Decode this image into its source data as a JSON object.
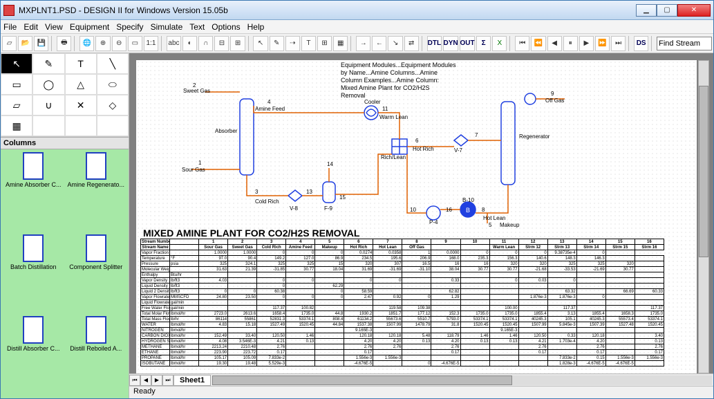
{
  "window": {
    "title": "MXPLNT1.PSD - DESIGN II for Windows Version 15.05b"
  },
  "menu": [
    "File",
    "Edit",
    "View",
    "Equipment",
    "Specify",
    "Simulate",
    "Text",
    "Options",
    "Help"
  ],
  "toolbar": {
    "find_placeholder": "Find Stream",
    "text_btns": [
      "DTL",
      "DYN",
      "OUT",
      "Σ",
      "DS"
    ]
  },
  "shape_tools": [
    "↖",
    "✎",
    "T",
    "╲",
    "▭",
    "◯",
    "△",
    "⬭",
    "▱",
    "∪",
    "✕",
    "◇",
    "▦"
  ],
  "columns_header": "Columns",
  "palette": [
    "Amine Absorber C...",
    "Amine Regenerato...",
    "Batch Distillation",
    "Component Splitter",
    "Distill Absorber C...",
    "Distill Reboiled A..."
  ],
  "sheet_tab": "Sheet1",
  "status": "Ready",
  "note_lines": [
    "Equipment Modules...Equipment Modules",
    "by Name...Amine Columns...Amine",
    "Column Examples...Amine Column:",
    "Mixed Amine Plant for CO2/H2S",
    "Removal"
  ],
  "diagram_title": "MIXED AMINE PLANT FOR CO2/H2S REMOVAL",
  "diagram_labels": {
    "sweet_gas": "Sweet Gas",
    "amine_feed": "Amine Feed",
    "absorber": "Absorber",
    "sour_gas": "Sour Gas",
    "cold_rich": "Cold Rich",
    "v8": "V-8",
    "f9": "F-9",
    "cooler": "Cooler",
    "warm_lean": "Warm Lean",
    "rich_lean": "Rich/Lean",
    "hot_rich": "Hot Rich",
    "v7": "V-7",
    "p4": "P-4",
    "b10": "B-10",
    "hot_lean": "Hot Lean",
    "makeup": "Makeup",
    "regenerator": "Regenerator",
    "off_gas": "Off Gas",
    "n2": "2",
    "n3": "3",
    "n4": "4",
    "n5": "5",
    "n6": "6",
    "n7": "7",
    "n8": "8",
    "n9": "9",
    "n10": "10",
    "n11": "11",
    "n13": "13",
    "n14": "14",
    "n15": "15",
    "n16": "16",
    "n1": "1"
  },
  "table": {
    "header": [
      "Stream Number",
      "",
      "1",
      "2",
      "3",
      "4",
      "5",
      "6",
      "7",
      "8",
      "9",
      "10",
      "11",
      "12",
      "13",
      "14",
      "15",
      "16"
    ],
    "sub": [
      "Stream Name",
      "",
      "Sour Gas",
      "Sweet Gas",
      "Cold Rich",
      "Amine Feed",
      "Makeup",
      "Hot Rich",
      "Hot Lean",
      "Off Gas",
      "",
      "",
      "Warm Lean",
      "Strm 12",
      "Strm 13",
      "Strm 14",
      "Strm 15",
      "Strm 16"
    ],
    "rows": [
      [
        "Vapor Fraction",
        "",
        "1.0000",
        "1.0000",
        "0",
        "0",
        "0",
        "0.0274",
        "0.0358",
        "1",
        "0.0000",
        "0",
        "0",
        "0",
        "9.38735e-4",
        "0",
        ""
      ],
      [
        "Temperature",
        "°F",
        "97.0",
        "90.4",
        "149.2",
        "127.0",
        "86.9",
        "234.5",
        "195.6",
        "206.9",
        "168.0",
        "235.3",
        "156.3",
        "140.6",
        "148.3",
        "146.3",
        "",
        ""
      ],
      [
        "Pressure",
        "psia",
        "325",
        "324.1",
        "325",
        "325",
        "15",
        "320",
        "307",
        "16.5",
        "16",
        "16",
        "320",
        "320",
        "325",
        "325",
        "320",
        ""
      ],
      [
        "Molecular Weight",
        "",
        "31.63",
        "21.39",
        "-31.85",
        "30.77",
        "18.04",
        "31.69",
        "-31.69",
        "-31.10",
        "38.04",
        "30.77",
        "30.77",
        "-21.68",
        "-33.53",
        "-21.69",
        "30.77",
        ""
      ],
      [
        "Enthalpy",
        "Btu/hr",
        "",
        "",
        "",
        "",
        "",
        "",
        "",
        "",
        "",
        "",
        "",
        "",
        "",
        "",
        "",
        ""
      ],
      [
        "Vapor Density",
        "lb/ft3",
        "4.03",
        "",
        "0",
        "0",
        "",
        "0",
        "0",
        "",
        "0.33",
        "",
        "0",
        "0.03",
        "0",
        "",
        "",
        ""
      ],
      [
        "Liquid Density",
        "lb/ft3",
        "",
        "",
        "0",
        "",
        "62.29",
        "",
        "",
        "",
        "",
        "",
        "",
        "",
        "",
        "",
        "",
        ""
      ],
      [
        "Liquid 2 Density",
        "lb/ft3",
        "0",
        "0",
        "60.38",
        "",
        "0",
        "58.59",
        "",
        "",
        "62.82",
        "",
        "",
        "",
        "63.32",
        "",
        "66.69",
        "60.33"
      ],
      [
        "Vapor Flowrate (STP)",
        "MMSCFD",
        "24.80",
        "23.50",
        "0",
        "0",
        "0",
        "2.47",
        "0.92",
        "0",
        "1.29",
        "",
        "",
        "1.876e-3",
        "1.876e-3",
        "0",
        "",
        ""
      ],
      [
        "Liquid Flowrate",
        "gal/min",
        "",
        "",
        "",
        "",
        "",
        "",
        "",
        "",
        "",
        "",
        "",
        "",
        "",
        "",
        "",
        ""
      ],
      [
        "Free Water Flowrate (STP)",
        "gal/min",
        "",
        "",
        "117.37",
        "100.82",
        "",
        "",
        "119.58",
        "109.38",
        "",
        "",
        "100.00",
        "",
        "117.37",
        "",
        "",
        "117.37"
      ],
      [
        "Total Molar Flowrate",
        "lbmol/hr",
        "2723.0",
        "2613.6",
        "1658.4",
        "1735.0",
        "44.8",
        "1930.2",
        "1851.7",
        "177.12",
        "152.3",
        "1735.0",
        "1735.0",
        "1855.4",
        "3.13",
        "1855.4",
        "1658.3",
        "1735.0"
      ],
      [
        "Total Mass Flowrate",
        "lb/hr",
        "86114",
        "55861",
        "52831.3",
        "53374.1",
        "808.4",
        "61134.2",
        "55673.6",
        "5510.7",
        "5793.0",
        "53374.1",
        "53374.1",
        "40245.3",
        "105.1",
        "40245.3",
        "55573.4",
        "53374.1"
      ],
      [
        "WATER",
        "lbmol/hr",
        "4.83",
        "15.18",
        "1527.49",
        "1520.45",
        "44.84",
        "1537.38",
        "1507.99",
        "1478.79",
        "31.8",
        "1520.45",
        "1520.45",
        "1507.99",
        "5.845e-3",
        "1507.39",
        "1527.48",
        "1520.45"
      ],
      [
        "NITROGEN",
        "lbmol/hr",
        "",
        "",
        "",
        "",
        "",
        "9.165E-3",
        "",
        "",
        "",
        "",
        "9.165E-3",
        "",
        "",
        "",
        "",
        ""
      ],
      [
        "CARBON DIOXIDE",
        "lbmol/hr",
        "152.49",
        "33.40",
        "120.50",
        "1.46",
        "",
        "120.18",
        "120.18",
        "5.48",
        "118.79",
        "1.46",
        "1.46",
        "120.50",
        "0.33",
        "120.18",
        "",
        "3.40"
      ],
      [
        "HYDROGEN SULFID",
        "lbmol/hr",
        "4.08",
        "3.546E-3",
        "4.21",
        "0.13",
        "",
        "4.20",
        "4.20",
        "0.13",
        "4.20",
        "0.13",
        "0.13",
        "4.21",
        "1.703e-4",
        "4.20",
        "",
        "0.13"
      ],
      [
        "METHANE",
        "lbmol/hr",
        "2213.24",
        "2210.48",
        "2.76",
        "",
        "",
        "2.76",
        "2.76",
        "",
        "2.76",
        "",
        "",
        "2.76",
        "",
        "2.76",
        "",
        "2.76"
      ],
      [
        "ETHANE",
        "lbmol/hr",
        "223.90",
        "223.72",
        "0.17",
        "",
        "",
        "0.17",
        "",
        "",
        "0.17",
        "",
        "",
        "0.17",
        "",
        "0.17",
        "",
        "0.17"
      ],
      [
        "PROPANE",
        "lbmol/hr",
        "105.17",
        "105.09",
        "7.833e-2",
        "",
        "",
        "1.556e-3",
        "1.556e-3",
        "",
        "",
        "",
        "",
        "",
        "7.833e-2",
        "0.15",
        "1.556e-3",
        "1.556e-3"
      ],
      [
        "ISOBUTANE",
        "lbmol/hr",
        "19.30",
        "19.48",
        "5.529e-3",
        "",
        "",
        "-4.676E-5",
        "",
        "0",
        "-4.676E-5",
        "",
        "",
        "",
        "1.828e-3",
        "-4.676E-5",
        "-4.676E-5",
        ""
      ]
    ]
  }
}
